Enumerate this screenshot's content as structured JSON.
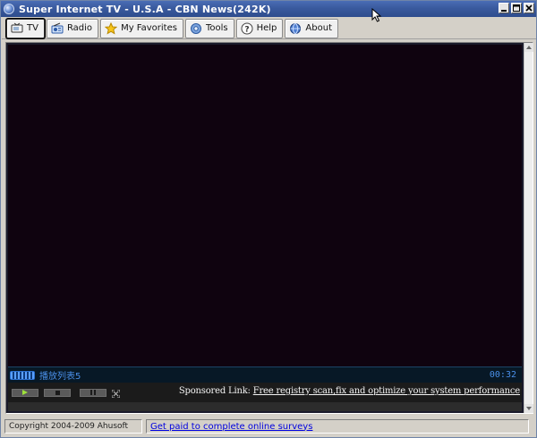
{
  "window": {
    "title": "Super Internet TV - U.S.A - CBN News(242K)"
  },
  "toolbar": {
    "buttons": [
      {
        "label": "TV",
        "icon": "tv-icon",
        "active": true
      },
      {
        "label": "Radio",
        "icon": "radio-icon"
      },
      {
        "label": "My Favorites",
        "icon": "star-icon"
      },
      {
        "label": "Tools",
        "icon": "gear-icon"
      },
      {
        "label": "Help",
        "icon": "help-icon"
      },
      {
        "label": "About",
        "icon": "globe-icon"
      }
    ]
  },
  "player": {
    "playlist_label": "播放列表5",
    "time": "00:32",
    "sponsor_prefix": "Sponsored Link: ",
    "sponsor_text": "Free registry scan,fix and optimize your system performance"
  },
  "statusbar": {
    "copyright": "Copyright 2004-2009 Ahusoft",
    "link": "Get paid to complete online surveys"
  },
  "colors": {
    "title_bar": "#3a5a9e",
    "video_bg": "#0f030f",
    "info_text": "#4a8fe8",
    "link": "#0000e0"
  }
}
